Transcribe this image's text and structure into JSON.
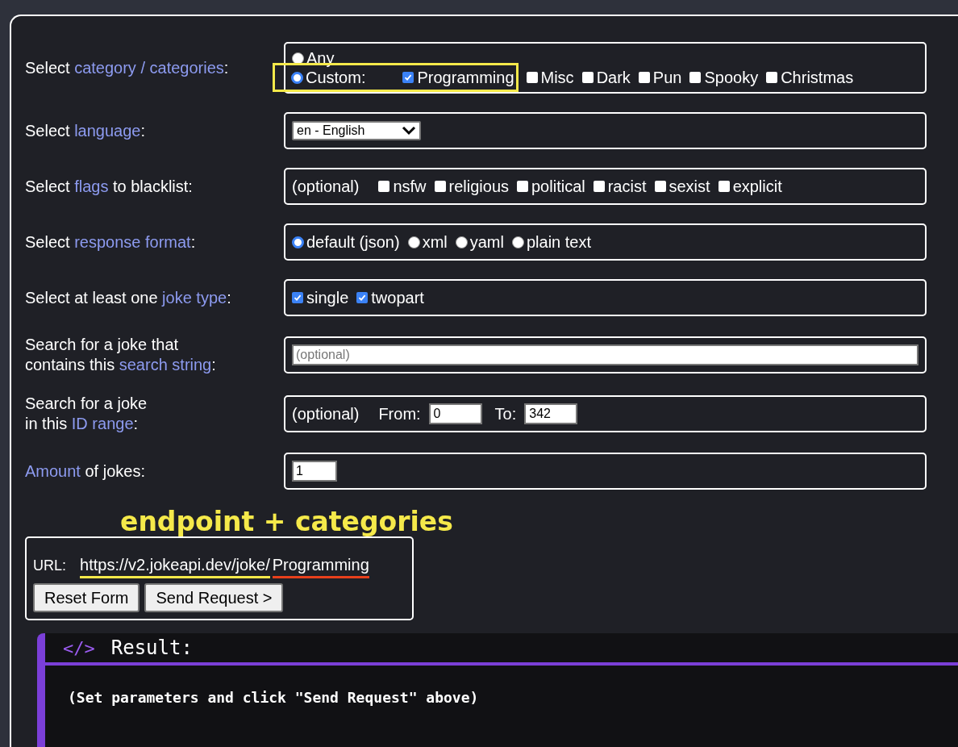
{
  "rows": [
    {
      "label": [
        {
          "text": "Select ",
          "link": false
        },
        {
          "text": "category / categories",
          "link": true
        },
        {
          "text": ":",
          "link": false
        }
      ],
      "lines": [
        [
          {
            "kind": "radio",
            "label": "Any",
            "selected": false,
            "highlighted": false
          }
        ],
        [
          {
            "kind": "radio",
            "label": "Custom:",
            "selected": true,
            "highlighted": true
          },
          {
            "kind": "checkbox",
            "label": "Programming",
            "checked": true,
            "highlighted": true
          },
          {
            "kind": "checkbox",
            "label": "Misc",
            "checked": false,
            "highlighted": false
          },
          {
            "kind": "checkbox",
            "label": "Dark",
            "checked": false,
            "highlighted": false
          },
          {
            "kind": "checkbox",
            "label": "Pun",
            "checked": false,
            "highlighted": false
          },
          {
            "kind": "checkbox",
            "label": "Spooky",
            "checked": false,
            "highlighted": false
          },
          {
            "kind": "checkbox",
            "label": "Christmas",
            "checked": false,
            "highlighted": false
          }
        ]
      ]
    },
    {
      "label": [
        {
          "text": "Select ",
          "link": false
        },
        {
          "text": "language",
          "link": true
        },
        {
          "text": ":",
          "link": false
        }
      ],
      "lines": [
        [
          {
            "kind": "select",
            "value": "en - English"
          }
        ]
      ]
    },
    {
      "label": [
        {
          "text": "Select ",
          "link": false
        },
        {
          "text": "flags",
          "link": true
        },
        {
          "text": " to blacklist:",
          "link": false
        }
      ],
      "lines": [
        [
          {
            "kind": "note",
            "text": "(optional)"
          },
          {
            "kind": "checkbox",
            "label": "nsfw",
            "checked": false
          },
          {
            "kind": "checkbox",
            "label": "religious",
            "checked": false
          },
          {
            "kind": "checkbox",
            "label": "political",
            "checked": false
          },
          {
            "kind": "checkbox",
            "label": "racist",
            "checked": false
          },
          {
            "kind": "checkbox",
            "label": "sexist",
            "checked": false
          },
          {
            "kind": "checkbox",
            "label": "explicit",
            "checked": false
          }
        ]
      ]
    },
    {
      "label": [
        {
          "text": "Select ",
          "link": false
        },
        {
          "text": "response format",
          "link": true
        },
        {
          "text": ":",
          "link": false
        }
      ],
      "lines": [
        [
          {
            "kind": "radio",
            "label": "default (json)",
            "selected": true
          },
          {
            "kind": "radio",
            "label": "xml",
            "selected": false
          },
          {
            "kind": "radio",
            "label": "yaml",
            "selected": false
          },
          {
            "kind": "radio",
            "label": "plain text",
            "selected": false
          }
        ]
      ]
    },
    {
      "label": [
        {
          "text": "Select at least one ",
          "link": false
        },
        {
          "text": "joke type",
          "link": true
        },
        {
          "text": ":",
          "link": false
        }
      ],
      "lines": [
        [
          {
            "kind": "checkbox",
            "label": "single",
            "checked": true
          },
          {
            "kind": "checkbox",
            "label": "twopart",
            "checked": true
          }
        ]
      ]
    },
    {
      "label": [
        {
          "text": "Search for a joke that\ncontains this ",
          "link": false
        },
        {
          "text": "search string",
          "link": true
        },
        {
          "text": ":",
          "link": false
        }
      ],
      "lines": [
        [
          {
            "kind": "search_input",
            "placeholder": "(optional)"
          }
        ]
      ]
    },
    {
      "label": [
        {
          "text": "Search for a joke\nin this ",
          "link": false
        },
        {
          "text": "ID range",
          "link": true
        },
        {
          "text": ":",
          "link": false
        }
      ],
      "lines": [
        [
          {
            "kind": "note",
            "text": "(optional)"
          },
          {
            "kind": "caption",
            "text": "From:"
          },
          {
            "kind": "number_input",
            "value": "0"
          },
          {
            "kind": "caption",
            "text": "To:"
          },
          {
            "kind": "number_input",
            "value": "342"
          }
        ]
      ]
    },
    {
      "label": [
        {
          "text": "Amount",
          "link": true
        },
        {
          "text": " of jokes:",
          "link": false
        }
      ],
      "lines": [
        [
          {
            "kind": "small_input",
            "value": "1"
          }
        ]
      ]
    }
  ],
  "annotation": "endpoint + categories",
  "url": {
    "label": "URL:",
    "parts": [
      {
        "text": "https://v2.jokeapi.dev/joke/",
        "color": "#f5e94a"
      },
      {
        "text": "Programming",
        "color": "#e8401c"
      }
    ]
  },
  "buttons": [
    "Reset Form",
    "Send Request >"
  ],
  "result": {
    "icon": "</>",
    "title": "Result:",
    "message": "(Set parameters and click \"Send Request\" above)"
  }
}
